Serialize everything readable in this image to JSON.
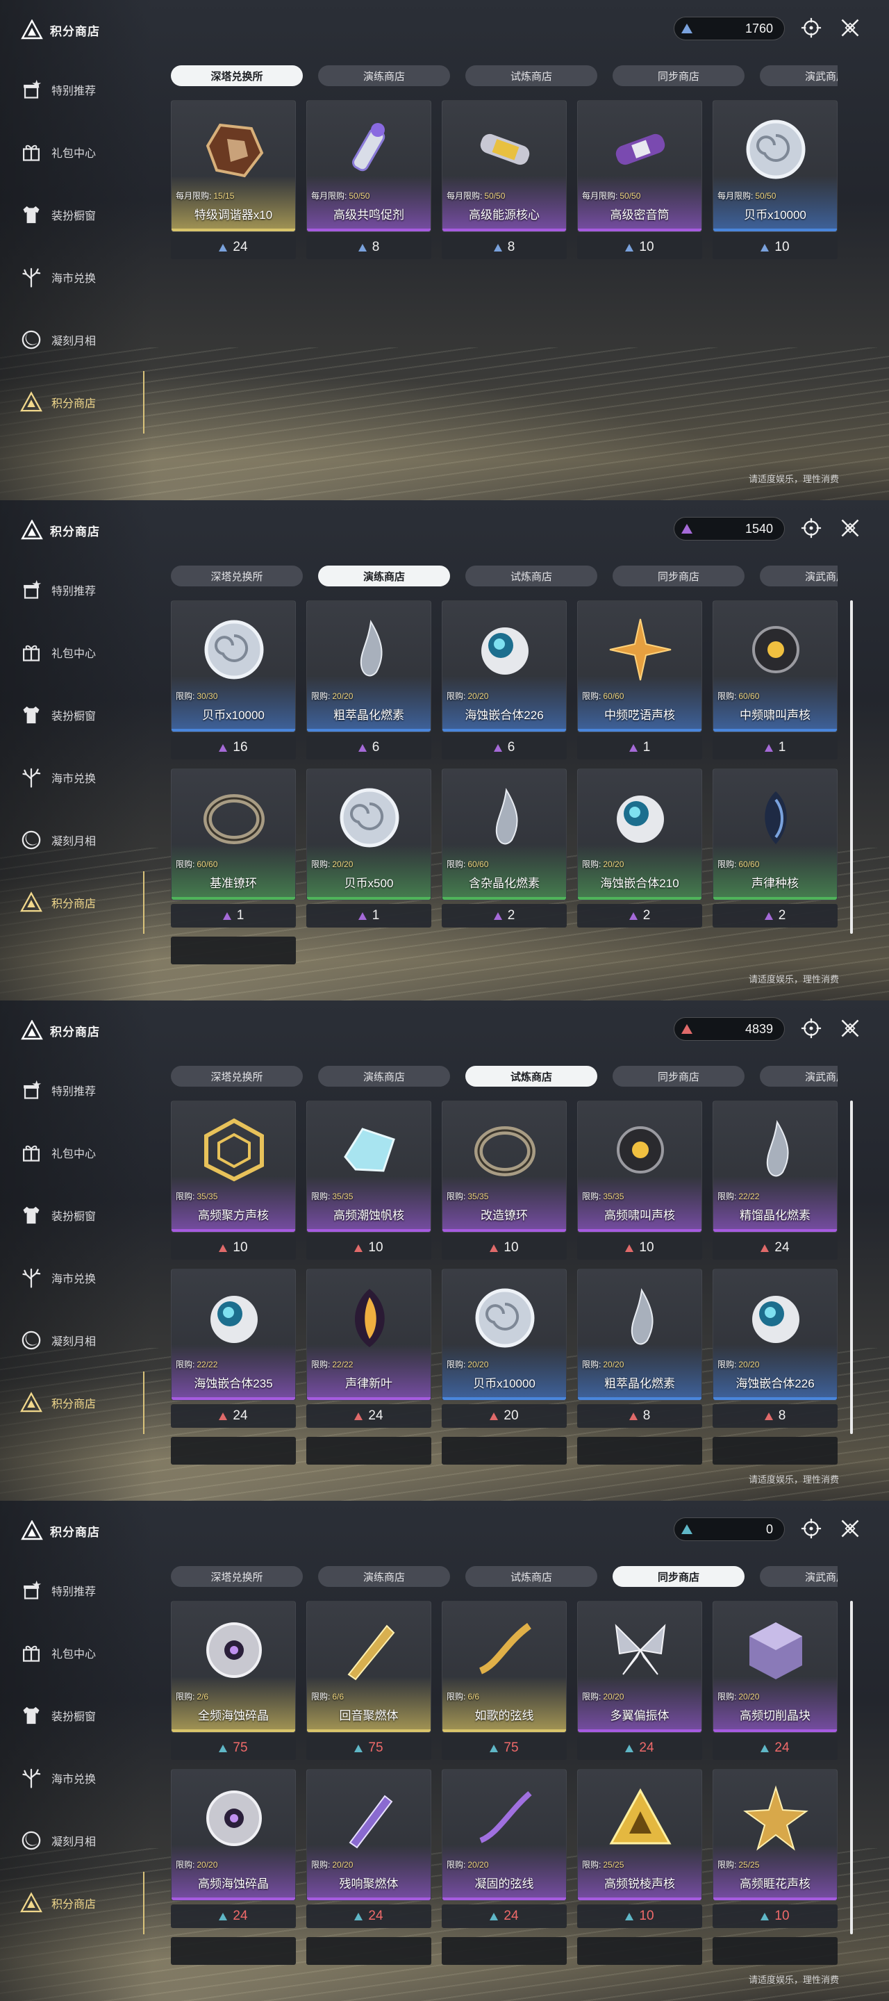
{
  "app": {
    "title": "积分商店",
    "notice": "请适度娱乐，理性消费"
  },
  "sidebar": {
    "items": [
      {
        "label": "特别推荐",
        "icon": "gift-star-icon"
      },
      {
        "label": "礼包中心",
        "icon": "gift-box-icon"
      },
      {
        "label": "装扮橱窗",
        "icon": "shirt-icon"
      },
      {
        "label": "海市兑换",
        "icon": "coral-icon"
      },
      {
        "label": "凝刻月相",
        "icon": "moon-icon"
      },
      {
        "label": "积分商店",
        "icon": "points-shop-icon"
      }
    ]
  },
  "tabs": [
    "深塔兑换所",
    "演练商店",
    "试炼商店",
    "同步商店",
    "演武商店"
  ],
  "colors": {
    "blue": "#7aa2dd",
    "purple": "#a56ad8",
    "red": "#e06a6a",
    "cyan": "#5fb7c7",
    "price_red": "#f06a6a"
  },
  "panels": [
    {
      "active_tab": 0,
      "currency": "1760",
      "currency_color": "#7aa2dd",
      "scrollbar": false,
      "items": [
        {
          "name": "特级调谐器x10",
          "limit_label": "每月限购:",
          "limit": "15/15",
          "price": "24",
          "quality": "gold",
          "icon": "tuner-icon"
        },
        {
          "name": "高级共鸣促剂",
          "limit_label": "每月限购:",
          "limit": "50/50",
          "price": "8",
          "quality": "purple",
          "icon": "potion-icon"
        },
        {
          "name": "高级能源核心",
          "limit_label": "每月限购:",
          "limit": "50/50",
          "price": "8",
          "quality": "purple",
          "icon": "energy-core-icon"
        },
        {
          "name": "高级密音筒",
          "limit_label": "每月限购:",
          "limit": "50/50",
          "price": "10",
          "quality": "purple",
          "icon": "sealed-tube-icon"
        },
        {
          "name": "贝币x10000",
          "limit_label": "每月限购:",
          "limit": "50/50",
          "price": "10",
          "quality": "blue",
          "icon": "shell-coin-icon"
        }
      ],
      "stubs": 0
    },
    {
      "active_tab": 1,
      "currency": "1540",
      "currency_color": "#a56ad8",
      "scrollbar": true,
      "items": [
        {
          "name": "贝币x10000",
          "limit_label": "限购:",
          "limit": "30/30",
          "price": "16",
          "quality": "blue",
          "icon": "shell-coin-icon"
        },
        {
          "name": "粗萃晶化燃素",
          "limit_label": "限购:",
          "limit": "20/20",
          "price": "6",
          "quality": "blue",
          "icon": "crystal-drop-icon"
        },
        {
          "name": "海蚀嵌合体226",
          "limit_label": "限购:",
          "limit": "20/20",
          "price": "6",
          "quality": "blue",
          "icon": "chimera-orb-icon"
        },
        {
          "name": "中频呓语声核",
          "limit_label": "限购:",
          "limit": "60/60",
          "price": "1",
          "quality": "blue",
          "icon": "star-core-icon"
        },
        {
          "name": "中频啸叫声核",
          "limit_label": "限购:",
          "limit": "60/60",
          "price": "1",
          "quality": "blue",
          "icon": "howl-core-icon"
        },
        {
          "name": "基准镣环",
          "limit_label": "限购:",
          "limit": "60/60",
          "price": "1",
          "quality": "green",
          "icon": "ring-icon"
        },
        {
          "name": "贝币x500",
          "limit_label": "限购:",
          "limit": "20/20",
          "price": "1",
          "quality": "green",
          "icon": "shell-coin-icon"
        },
        {
          "name": "含杂晶化燃素",
          "limit_label": "限购:",
          "limit": "60/60",
          "price": "2",
          "quality": "green",
          "icon": "crystal-drop-icon"
        },
        {
          "name": "海蚀嵌合体210",
          "limit_label": "限购:",
          "limit": "20/20",
          "price": "2",
          "quality": "green",
          "icon": "chimera-orb-icon"
        },
        {
          "name": "声律种核",
          "limit_label": "限购:",
          "limit": "60/60",
          "price": "2",
          "quality": "green",
          "icon": "seed-core-icon"
        }
      ],
      "stubs": 1
    },
    {
      "active_tab": 2,
      "currency": "4839",
      "currency_color": "#e06a6a",
      "scrollbar": true,
      "items": [
        {
          "name": "高频聚方声核",
          "limit_label": "限购:",
          "limit": "35/35",
          "price": "10",
          "quality": "purple",
          "icon": "cube-core-icon"
        },
        {
          "name": "高频潮蚀帆核",
          "limit_label": "限购:",
          "limit": "35/35",
          "price": "10",
          "quality": "purple",
          "icon": "sail-core-icon"
        },
        {
          "name": "改造镣环",
          "limit_label": "限购:",
          "limit": "35/35",
          "price": "10",
          "quality": "purple",
          "icon": "ring-icon"
        },
        {
          "name": "高频啸叫声核",
          "limit_label": "限购:",
          "limit": "35/35",
          "price": "10",
          "quality": "purple",
          "icon": "howl-core-icon"
        },
        {
          "name": "精馏晶化燃素",
          "limit_label": "限购:",
          "limit": "22/22",
          "price": "24",
          "quality": "purple",
          "icon": "crystal-drop-icon"
        },
        {
          "name": "海蚀嵌合体235",
          "limit_label": "限购:",
          "limit": "22/22",
          "price": "24",
          "quality": "purple",
          "icon": "chimera-orb-icon"
        },
        {
          "name": "声律新叶",
          "limit_label": "限购:",
          "limit": "22/22",
          "price": "24",
          "quality": "purple",
          "icon": "flame-leaf-icon"
        },
        {
          "name": "贝币x10000",
          "limit_label": "限购:",
          "limit": "20/20",
          "price": "20",
          "quality": "blue",
          "icon": "shell-coin-icon"
        },
        {
          "name": "粗萃晶化燃素",
          "limit_label": "限购:",
          "limit": "20/20",
          "price": "8",
          "quality": "blue",
          "icon": "crystal-drop-icon"
        },
        {
          "name": "海蚀嵌合体226",
          "limit_label": "限购:",
          "limit": "20/20",
          "price": "8",
          "quality": "blue",
          "icon": "chimera-orb-icon"
        }
      ],
      "stubs": 5
    },
    {
      "active_tab": 3,
      "currency": "0",
      "currency_color": "#5fb7c7",
      "scrollbar": true,
      "price_red": true,
      "items": [
        {
          "name": "全频海蚀碎晶",
          "limit_label": "限购:",
          "limit": "2/6",
          "price": "75",
          "quality": "gold",
          "icon": "shard-disc-icon"
        },
        {
          "name": "回音聚燃体",
          "limit_label": "限购:",
          "limit": "6/6",
          "price": "75",
          "quality": "gold",
          "icon": "golden-blade-icon"
        },
        {
          "name": "如歌的弦线",
          "limit_label": "限购:",
          "limit": "6/6",
          "price": "75",
          "quality": "gold",
          "icon": "golden-string-icon"
        },
        {
          "name": "多翼偏振体",
          "limit_label": "限购:",
          "limit": "20/20",
          "price": "24",
          "quality": "purple",
          "icon": "butterfly-icon"
        },
        {
          "name": "高频切削晶块",
          "limit_label": "限购:",
          "limit": "20/20",
          "price": "24",
          "quality": "purple",
          "icon": "crystal-block-icon"
        },
        {
          "name": "高频海蚀碎晶",
          "limit_label": "限购:",
          "limit": "20/20",
          "price": "24",
          "quality": "purple",
          "icon": "shard-disc-icon"
        },
        {
          "name": "残响聚燃体",
          "limit_label": "限购:",
          "limit": "20/20",
          "price": "24",
          "quality": "purple",
          "icon": "blade-icon"
        },
        {
          "name": "凝固的弦线",
          "limit_label": "限购:",
          "limit": "20/20",
          "price": "24",
          "quality": "purple",
          "icon": "string-icon"
        },
        {
          "name": "高频锐棱声核",
          "limit_label": "限购:",
          "limit": "25/25",
          "price": "10",
          "quality": "purple",
          "icon": "triangle-core-icon"
        },
        {
          "name": "高频睚花声核",
          "limit_label": "限购:",
          "limit": "25/25",
          "price": "10",
          "quality": "purple",
          "icon": "flower-core-icon"
        }
      ],
      "stubs": 5
    }
  ]
}
